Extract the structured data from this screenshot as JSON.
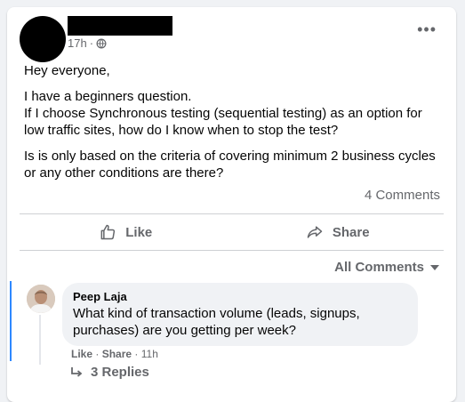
{
  "post": {
    "time": "17h",
    "separator": "·",
    "paragraphs": [
      "Hey everyone,",
      "I have a beginners question.\nIf I choose Synchronous testing (sequential testing) as an option for low traffic sites, how do I know when to stop the test?",
      "Is is only based on the criteria of covering minimum 2 business cycles or any other conditions are there?"
    ],
    "comments_count": "4 Comments",
    "like_label": "Like",
    "share_label": "Share",
    "more_label": "•••",
    "audience_icon": "globe-icon"
  },
  "comments": {
    "sort_label": "All Comments",
    "items": [
      {
        "name": "Peep Laja",
        "text": "What kind of transaction volume (leads, signups, purchases) are you getting per week?",
        "like": "Like",
        "share": "Share",
        "time": "11h",
        "replies": "3 Replies"
      }
    ]
  },
  "colors": {
    "secondary_text": "#65676b",
    "thread_accent": "#2d88ff",
    "bubble_bg": "#f0f2f5"
  }
}
